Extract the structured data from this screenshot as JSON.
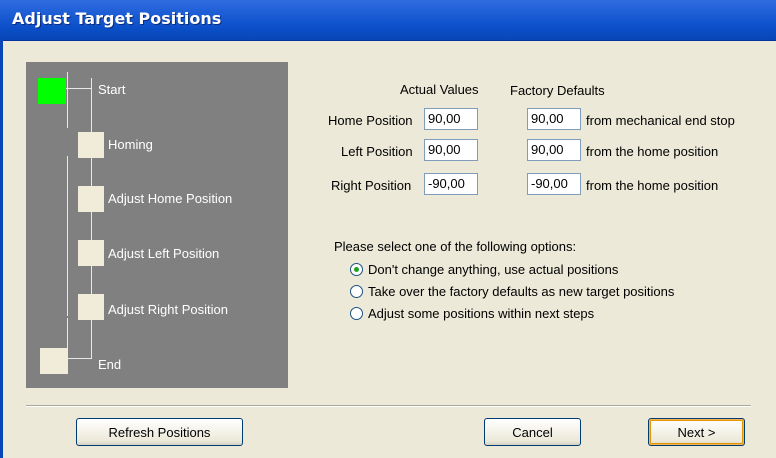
{
  "window": {
    "title": "Adjust Target Positions"
  },
  "steps": [
    {
      "label": "Start",
      "active": true
    },
    {
      "label": "Homing",
      "active": false
    },
    {
      "label": "Adjust Home Position",
      "active": false
    },
    {
      "label": "Adjust Left Position",
      "active": false
    },
    {
      "label": "Adjust Right Position",
      "active": false
    },
    {
      "label": "End",
      "active": false
    }
  ],
  "headers": {
    "actual": "Actual Values",
    "factory": "Factory Defaults"
  },
  "rows": [
    {
      "label": "Home Position",
      "actual": "90,00",
      "factory": "90,00",
      "note": "from mechanical end stop"
    },
    {
      "label": "Left Position",
      "actual": "90,00",
      "factory": "90,00",
      "note": "from the home position"
    },
    {
      "label": "Right Position",
      "actual": "-90,00",
      "factory": "-90,00",
      "note": "from the home position"
    }
  ],
  "options": {
    "prompt": "Please select one of the following options:",
    "items": [
      {
        "label": "Don't change anything, use actual positions",
        "selected": true
      },
      {
        "label": "Take over the factory defaults as new target positions",
        "selected": false
      },
      {
        "label": "Adjust some positions within next steps",
        "selected": false
      }
    ]
  },
  "buttons": {
    "refresh": "Refresh Positions",
    "cancel": "Cancel",
    "next": "Next >"
  }
}
